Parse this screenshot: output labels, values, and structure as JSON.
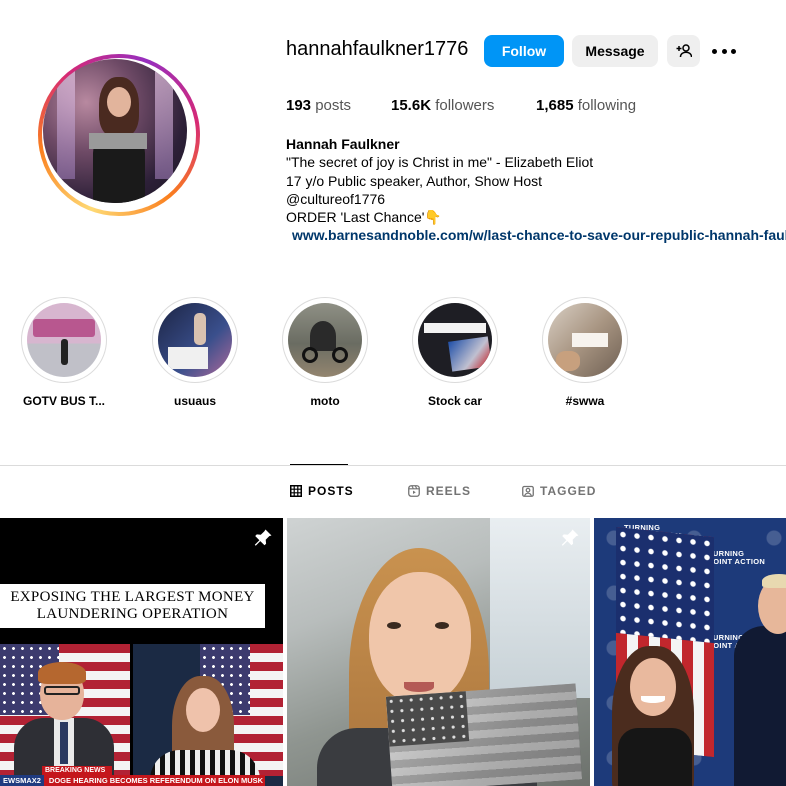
{
  "profile": {
    "username": "hannahfaulkner1776",
    "follow_label": "Follow",
    "message_label": "Message",
    "stats": {
      "posts_count": "193",
      "posts_label": "posts",
      "followers_count": "15.6K",
      "followers_label": "followers",
      "following_count": "1,685",
      "following_label": "following"
    },
    "bio": {
      "name": "Hannah Faulkner",
      "lines": [
        "\"The secret of joy is Christ in me\" - Elizabeth Eliot",
        "17 y/o Public speaker, Author, Show Host",
        "@cultureof1776",
        "ORDER 'Last Chance'👇"
      ],
      "link": "www.barnesandnoble.com/w/last-chance-to-save-our-republic-hannah-faulk"
    }
  },
  "highlights": [
    {
      "label": "GOTV BUS T...",
      "thumb_color": "#c9a5c2"
    },
    {
      "label": "usuaus",
      "thumb_color": "#2b3a6b"
    },
    {
      "label": "moto",
      "thumb_color": "#7d7e73"
    },
    {
      "label": "Stock car",
      "thumb_color": "#1e1e24"
    },
    {
      "label": "#swwa",
      "thumb_color": "#b7a898"
    }
  ],
  "tabs": [
    {
      "label": "POSTS",
      "active": true
    },
    {
      "label": "REELS",
      "active": false
    },
    {
      "label": "TAGGED",
      "active": false
    }
  ],
  "posts": [
    {
      "pinned": true,
      "headline": "EXPOSING THE LARGEST MONEY LAUNDERING OPERATION",
      "breaking": "BREAKING NEWS",
      "ticker_tag": "EWSMAX2",
      "ticker": "DOGE HEARING BECOMES REFERENDUM ON ELON MUSK"
    },
    {
      "pinned": true
    },
    {
      "pinned": false,
      "logo_text": [
        "TURNING",
        "POINT ACTION"
      ]
    }
  ],
  "colors": {
    "accent": "#0095f6",
    "secondary_button": "#efefef",
    "link": "#00376b",
    "border": "#dbdbdb"
  }
}
